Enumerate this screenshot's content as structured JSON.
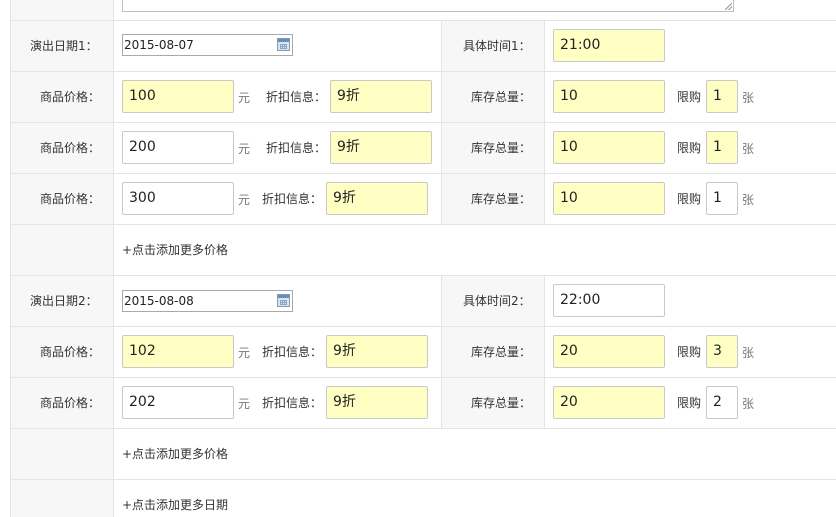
{
  "show1": {
    "date_label": "演出日期1：",
    "date_value": "2015-08-07",
    "time_label": "具体时间1：",
    "time_value": "21:00",
    "prices": [
      {
        "price_label": "商品价格：",
        "price": "100",
        "unit": "元",
        "discount_label": "折扣信息：",
        "discount": "9折",
        "stock_label": "库存总量：",
        "stock": "10",
        "limit_label": "限购",
        "limit": "1",
        "limit_unit": "张"
      },
      {
        "price_label": "商品价格：",
        "price": "200",
        "unit": "元",
        "discount_label": "折扣信息：",
        "discount": "9折",
        "stock_label": "库存总量：",
        "stock": "10",
        "limit_label": "限购",
        "limit": "1",
        "limit_unit": "张"
      },
      {
        "price_label": "商品价格：",
        "price": "300",
        "unit": "元",
        "discount_label": "折扣信息：",
        "discount": "9折",
        "stock_label": "库存总量：",
        "stock": "10",
        "limit_label": "限购",
        "limit": "1",
        "limit_unit": "张"
      }
    ],
    "add_price": "+点击添加更多价格"
  },
  "show2": {
    "date_label": "演出日期2：",
    "date_value": "2015-08-08",
    "time_label": "具体时间2：",
    "time_value": "22:00",
    "prices": [
      {
        "price_label": "商品价格：",
        "price": "102",
        "unit": "元",
        "discount_label": "折扣信息：",
        "discount": "9折",
        "stock_label": "库存总量：",
        "stock": "20",
        "limit_label": "限购",
        "limit": "3",
        "limit_unit": "张"
      },
      {
        "price_label": "商品价格：",
        "price": "202",
        "unit": "元",
        "discount_label": "折扣信息：",
        "discount": "9折",
        "stock_label": "库存总量：",
        "stock": "20",
        "limit_label": "限购",
        "limit": "2",
        "limit_unit": "张"
      }
    ],
    "add_price": "+点击添加更多价格"
  },
  "add_date": "+点击添加更多日期",
  "colors": {
    "highlight": "#ffffc4",
    "label_bg": "#f7f7f7",
    "border": "#e4e4e4"
  }
}
